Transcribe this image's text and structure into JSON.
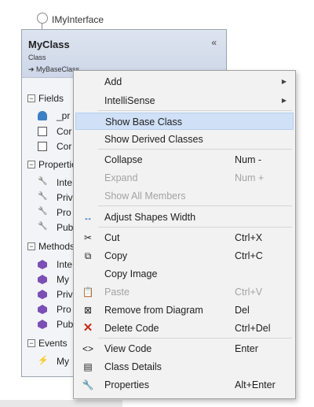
{
  "diagram": {
    "interface_label": "IMyInterface",
    "class_name": "MyClass",
    "class_kind": "Class",
    "base_class": "MyBaseClass",
    "collapse_glyph": "«",
    "sections": {
      "fields": "Fields",
      "properties": "Properties",
      "methods": "Methods",
      "events": "Events"
    },
    "members": {
      "field_1": "_pr",
      "field_2": "Cor",
      "field_3": "Cor",
      "prop_1": "Inte",
      "prop_2": "Priv",
      "prop_3": "Pro",
      "prop_4": "Pub",
      "method_1": "Inte",
      "method_2": "My",
      "method_3": "Priv",
      "method_4": "Pro",
      "method_5": "Pub",
      "event_1": "My"
    }
  },
  "menu": {
    "items": [
      {
        "label": "Add",
        "shortcut": "",
        "submenu": true
      },
      {
        "label": "IntelliSense",
        "shortcut": "",
        "submenu": true
      },
      {
        "label": "Show Base Class",
        "shortcut": ""
      },
      {
        "label": "Show Derived Classes",
        "shortcut": ""
      },
      {
        "label": "Collapse",
        "shortcut": "Num -"
      },
      {
        "label": "Expand",
        "shortcut": "Num +"
      },
      {
        "label": "Show All Members",
        "shortcut": ""
      },
      {
        "label": "Adjust Shapes Width",
        "shortcut": "",
        "icon": "adjust-width-icon"
      },
      {
        "label": "Cut",
        "shortcut": "Ctrl+X",
        "icon": "scissors-icon"
      },
      {
        "label": "Copy",
        "shortcut": "Ctrl+C",
        "icon": "copy-icon"
      },
      {
        "label": "Copy Image",
        "shortcut": ""
      },
      {
        "label": "Paste",
        "shortcut": "Ctrl+V",
        "icon": "paste-icon"
      },
      {
        "label": "Remove from Diagram",
        "shortcut": "Del",
        "icon": "remove-from-diagram-icon"
      },
      {
        "label": "Delete Code",
        "shortcut": "Ctrl+Del",
        "icon": "delete-icon"
      },
      {
        "label": "View Code",
        "shortcut": "Enter",
        "icon": "view-code-icon"
      },
      {
        "label": "Class Details",
        "shortcut": "",
        "icon": "class-details-icon"
      },
      {
        "label": "Properties",
        "shortcut": "Alt+Enter",
        "icon": "wrench-icon"
      }
    ],
    "highlight_color": "#cfe0f7",
    "delete_icon_color": "#c42b1c"
  }
}
